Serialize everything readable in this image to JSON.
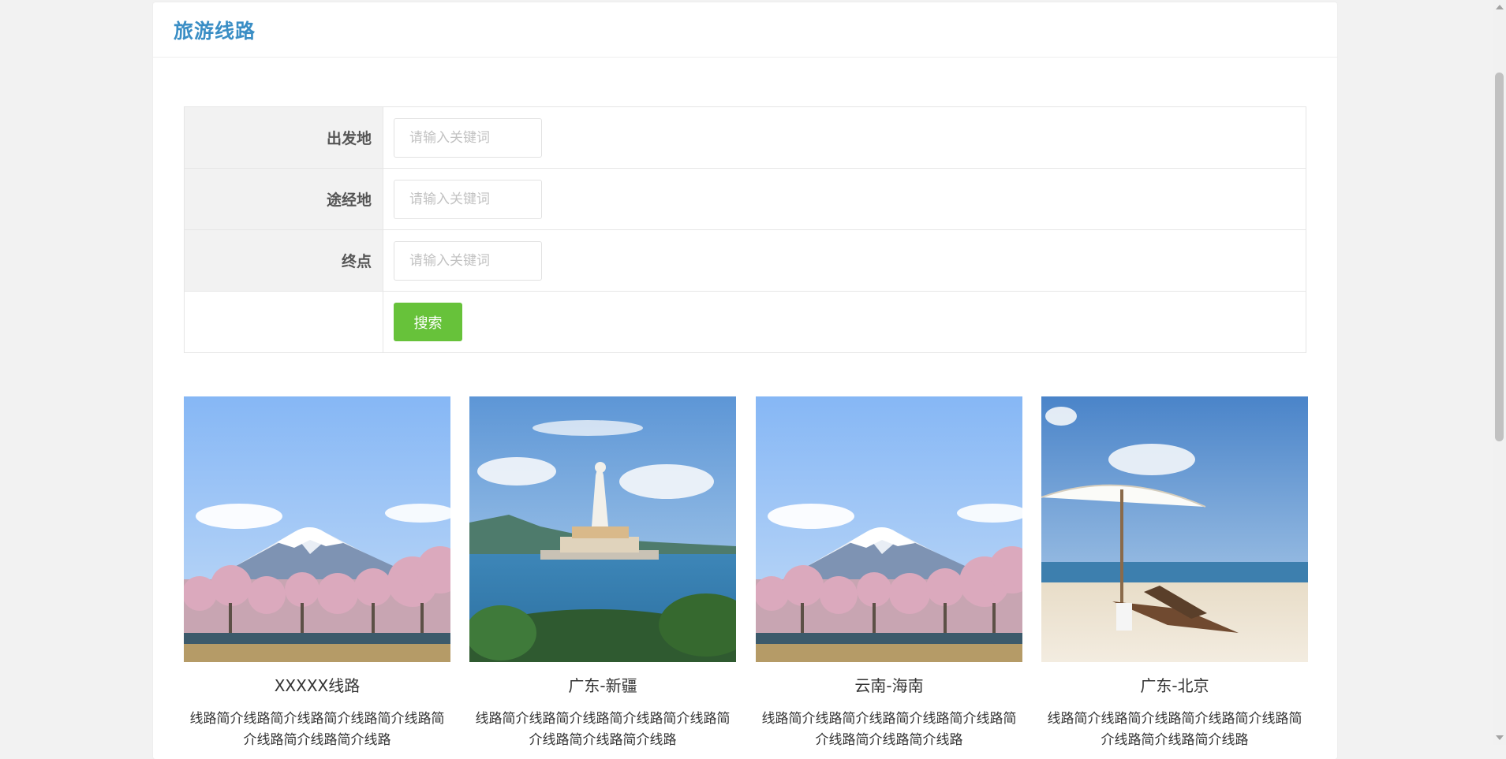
{
  "panel": {
    "title": "旅游线路"
  },
  "search": {
    "fields": [
      {
        "label": "出发地",
        "placeholder": "请输入关键词",
        "value": ""
      },
      {
        "label": "途经地",
        "placeholder": "请输入关键词",
        "value": ""
      },
      {
        "label": "终点",
        "placeholder": "请输入关键词",
        "value": ""
      }
    ],
    "button_label": "搜索"
  },
  "routes": [
    {
      "name": "XXXXX线路",
      "description": "线路简介线路简介线路简介线路简介线路简介线路简介线路简介线路",
      "image": "mountain-blossom-photo"
    },
    {
      "name": "广东-新疆",
      "description": "线路简介线路简介线路简介线路简介线路简介线路简介线路简介线路",
      "image": "guanyin-statue-island-photo"
    },
    {
      "name": "云南-海南",
      "description": "线路简介线路简介线路简介线路简介线路简介线路简介线路简介线路",
      "image": "mountain-blossom-photo"
    },
    {
      "name": "广东-北京",
      "description": "线路简介线路简介线路简介线路简介线路简介线路简介线路简介线路",
      "image": "beach-umbrella-photo"
    }
  ],
  "colors": {
    "title": "#3a8ec5",
    "button": "#67c23a",
    "label_bg": "#f2f2f2"
  }
}
